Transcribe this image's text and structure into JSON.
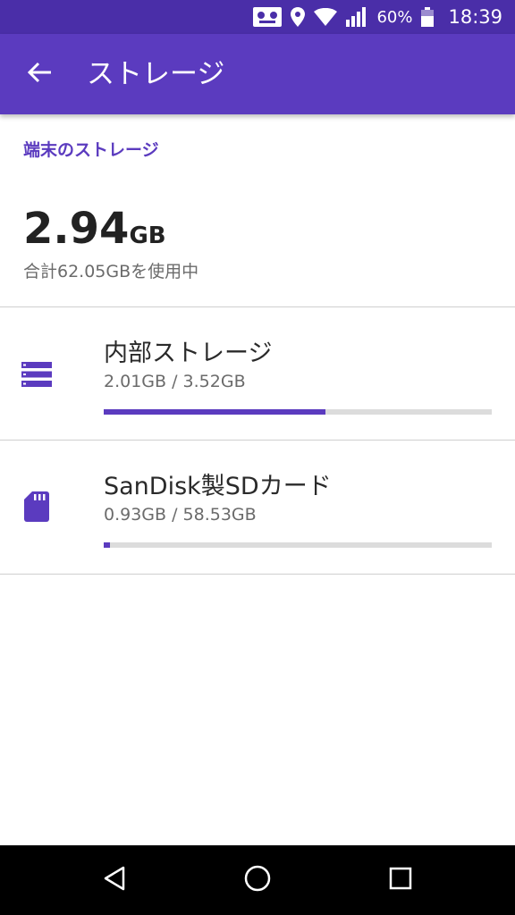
{
  "status_bar": {
    "battery_text": "60%",
    "time": "18:39"
  },
  "app_bar": {
    "title": "ストレージ",
    "back_icon": "arrow-back-icon"
  },
  "device_storage": {
    "section_label": "端末のストレージ",
    "used_value": "2.94",
    "used_unit": "GB",
    "total_text": "合計62.05GBを使用中"
  },
  "storage_items": [
    {
      "icon": "internal-storage-icon",
      "title": "内部ストレージ",
      "usage": "2.01GB / 3.52GB",
      "fraction": 0.571
    },
    {
      "icon": "sd-card-icon",
      "title": "SanDisk製SDカード",
      "usage": "0.93GB / 58.53GB",
      "fraction": 0.016
    }
  ],
  "navigation": {
    "back_icon": "nav-back-icon",
    "home_icon": "nav-home-icon",
    "recents_icon": "nav-recents-icon"
  },
  "colors": {
    "status_bar": "#4a2ea8",
    "app_bar": "#5b3bbf",
    "accent": "#5b3bbf",
    "bar_track": "#dcdcdc"
  }
}
